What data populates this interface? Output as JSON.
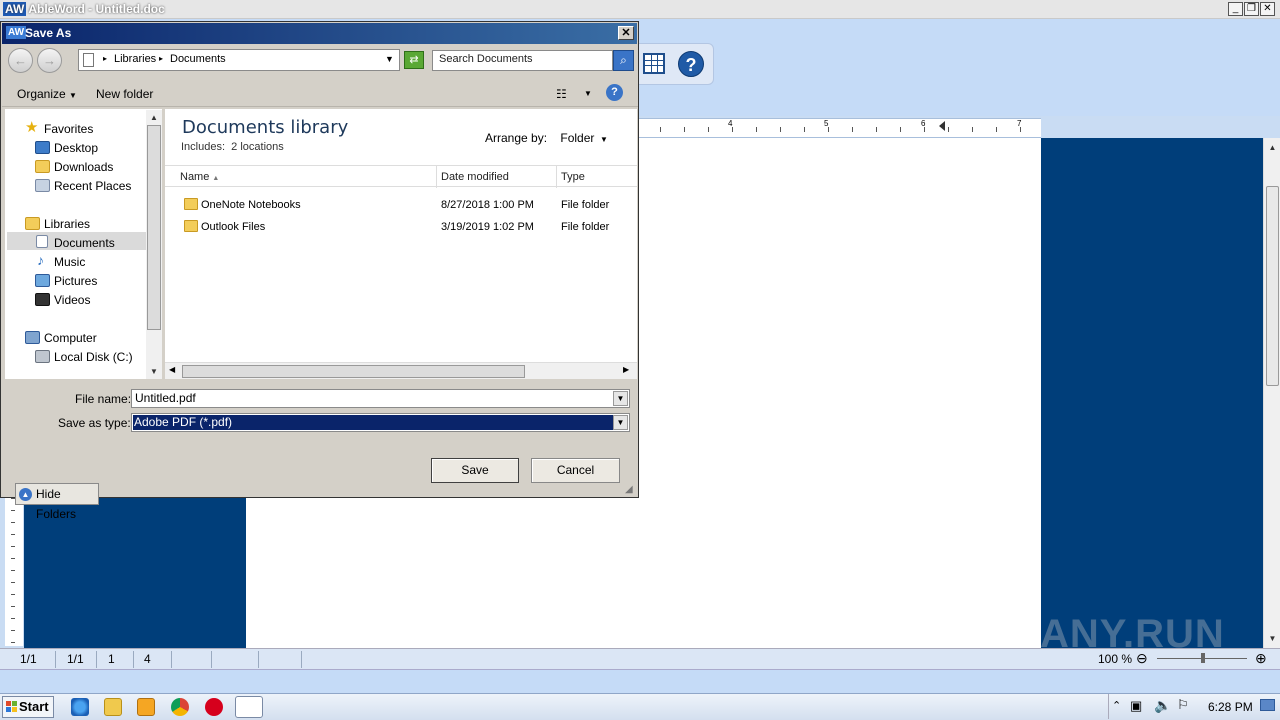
{
  "app": {
    "logo": "AW",
    "title": "AbleWord - Untitled.doc",
    "min": "_",
    "restore": "❐",
    "close": "✕"
  },
  "dialog": {
    "logo": "AW",
    "title": "Save As",
    "close": "✕",
    "breadcrumb": [
      "Libraries",
      "Documents"
    ],
    "search_placeholder": "Search Documents",
    "toolbar": {
      "organize": "Organize",
      "new_folder": "New folder"
    },
    "nav": {
      "favorites": "Favorites",
      "favorites_items": [
        "Desktop",
        "Downloads",
        "Recent Places"
      ],
      "libraries": "Libraries",
      "libraries_items": [
        "Documents",
        "Music",
        "Pictures",
        "Videos"
      ],
      "computer": "Computer",
      "computer_items": [
        "Local Disk (C:)"
      ]
    },
    "library": {
      "title": "Documents library",
      "includes": "Includes:",
      "locations": "2 locations",
      "arrange_by": "Arrange by:",
      "arrange_value": "Folder"
    },
    "columns": {
      "name": "Name",
      "date": "Date modified",
      "type": "Type"
    },
    "files": [
      {
        "name": "OneNote Notebooks",
        "date": "8/27/2018 1:00 PM",
        "type": "File folder"
      },
      {
        "name": "Outlook Files",
        "date": "3/19/2019 1:02 PM",
        "type": "File folder"
      }
    ],
    "file_name_label": "File name:",
    "file_name_value": "Untitled.pdf",
    "save_type_label": "Save as type:",
    "save_type_value": "Adobe PDF (*.pdf)",
    "hide_folders": "Hide Folders",
    "save": "Save",
    "cancel": "Cancel"
  },
  "ruler": {
    "marks": [
      "4",
      "5",
      "6",
      "7"
    ]
  },
  "status": {
    "page": "1/1",
    "section": "1/1",
    "col": "1",
    "line": "4",
    "zoom": "100 %"
  },
  "taskbar": {
    "start": "Start",
    "clock": "6:28 PM"
  },
  "watermark": "ANY.RUN",
  "colors": {
    "doc_bg": "#003e7a",
    "dialog_title": "#0a246a",
    "selection": "#0a246a"
  }
}
